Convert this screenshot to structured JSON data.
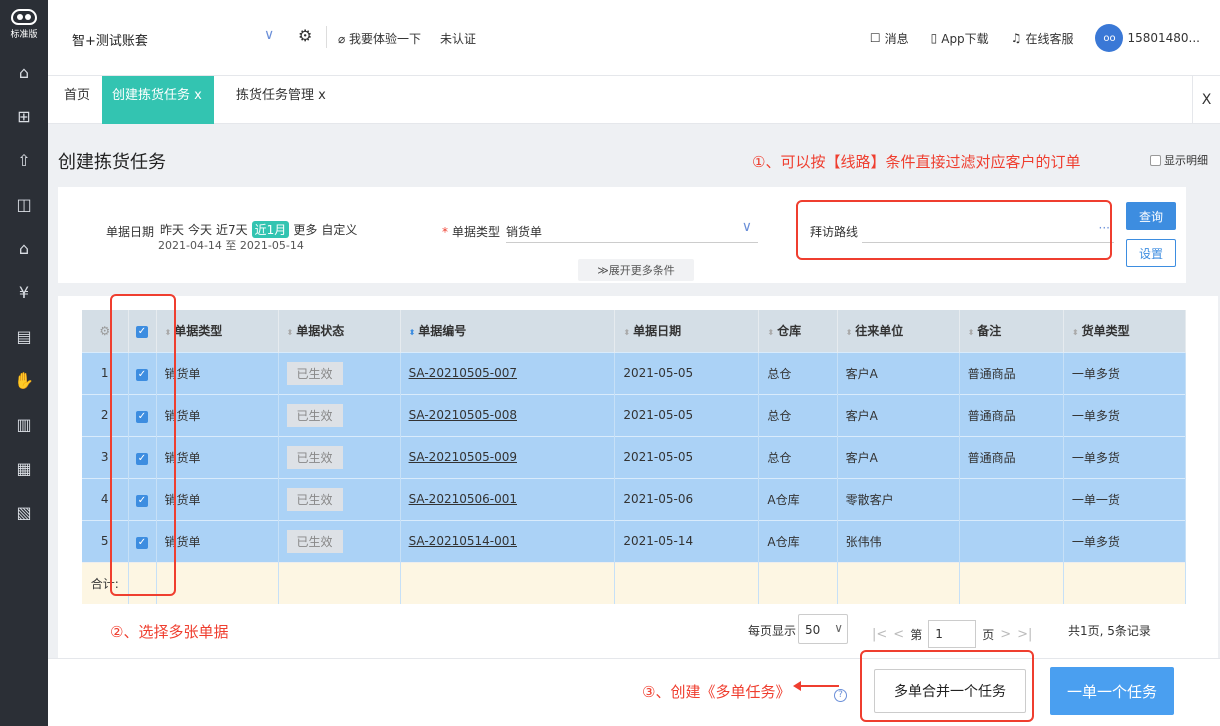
{
  "logo": {
    "edition": "标准版"
  },
  "sidebar": {
    "icons": [
      "home-icon",
      "gift-icon",
      "upload-icon",
      "bag-icon",
      "store-icon",
      "money-bag-icon",
      "receipt-icon",
      "hand-icon",
      "document-icon",
      "clipboard-icon",
      "report-icon"
    ]
  },
  "topbar": {
    "account": "智+测试账套",
    "try_label": "我要体验一下",
    "unverified": "未认证",
    "messages": "消息",
    "app_download": "App下载",
    "service": "在线客服",
    "user": "15801480..."
  },
  "tabs": [
    {
      "label": "首页"
    },
    {
      "label": "创建拣货任务 x",
      "active": true
    },
    {
      "label": "拣货任务管理 x"
    }
  ],
  "tabs_close": "X",
  "page": {
    "title": "创建拣货任务",
    "annotation1": "①、可以按【线路】条件直接过滤对应客户的订单",
    "detail_toggle": "显示明细"
  },
  "filter": {
    "date_label": "单据日期",
    "date_options": [
      "昨天",
      "今天",
      "近7天",
      "近1月",
      "更多",
      "自定义"
    ],
    "date_selected": "近1月",
    "date_range": "2021-04-14 至 2021-05-14",
    "type_label": "单据类型",
    "type_value": "销货单",
    "expand": "展开更多条件",
    "route_label": "拜访路线",
    "route_dots": "···",
    "query": "查询",
    "settings": "设置"
  },
  "table": {
    "headers": [
      "单据类型",
      "单据状态",
      "单据编号",
      "单据日期",
      "仓库",
      "往来单位",
      "备注",
      "货单类型"
    ],
    "rows": [
      {
        "n": "1",
        "type": "销货单",
        "status": "已生效",
        "code": "SA-20210505-007",
        "date": "2021-05-05",
        "wh": "总仓",
        "party": "客户A",
        "note": "普通商品",
        "kind": "一单多货"
      },
      {
        "n": "2",
        "type": "销货单",
        "status": "已生效",
        "code": "SA-20210505-008",
        "date": "2021-05-05",
        "wh": "总仓",
        "party": "客户A",
        "note": "普通商品",
        "kind": "一单多货"
      },
      {
        "n": "3",
        "type": "销货单",
        "status": "已生效",
        "code": "SA-20210505-009",
        "date": "2021-05-05",
        "wh": "总仓",
        "party": "客户A",
        "note": "普通商品",
        "kind": "一单多货"
      },
      {
        "n": "4",
        "type": "销货单",
        "status": "已生效",
        "code": "SA-20210506-001",
        "date": "2021-05-06",
        "wh": "A仓库",
        "party": "零散客户",
        "note": "",
        "kind": "一单一货"
      },
      {
        "n": "5",
        "type": "销货单",
        "status": "已生效",
        "code": "SA-20210514-001",
        "date": "2021-05-14",
        "wh": "A仓库",
        "party": "张伟伟",
        "note": "",
        "kind": "一单多货"
      }
    ],
    "total_label": "合计:"
  },
  "annotation2": "②、选择多张单据",
  "pager": {
    "per_label": "每页显示",
    "per_value": "50",
    "page_prefix": "第",
    "page_value": "1",
    "page_suffix": "页",
    "summary": "共1页, 5条记录"
  },
  "bottom": {
    "annotation3": "③、创建《多单任务》",
    "merge": "多单合并一个任务",
    "single": "一单一个任务"
  },
  "colors": {
    "accent": "#33c4b1",
    "primary": "#3d8de0",
    "annotation": "#ef3e2f",
    "selected_row": "#abd2f6"
  }
}
